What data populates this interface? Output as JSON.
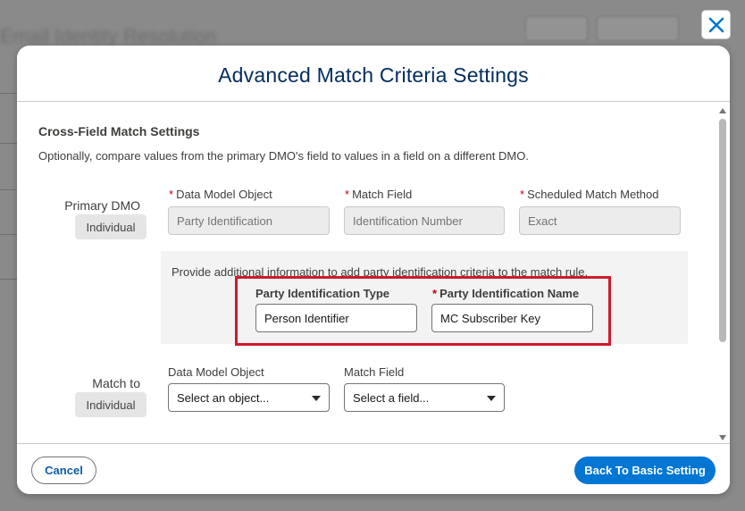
{
  "background": {
    "page_title": "Email Identity Resolution"
  },
  "close_icon": "close-icon",
  "modal": {
    "title": "Advanced Match Criteria Settings"
  },
  "section": {
    "title": "Cross-Field Match Settings",
    "description": "Optionally, compare values from the primary DMO's field to values in a field on a different DMO."
  },
  "primary": {
    "label": "Primary DMO",
    "badge": "Individual",
    "fields": [
      {
        "label": "Data Model Object",
        "required": true,
        "value": "Party Identification"
      },
      {
        "label": "Match Field",
        "required": true,
        "value": "Identification Number"
      },
      {
        "label": "Scheduled Match Method",
        "required": true,
        "value": "Exact"
      }
    ],
    "required_marker": "*"
  },
  "party_info": {
    "text": "Provide additional information to add party identification criteria to the match rule.",
    "type_label": "Party Identification Type",
    "type_value": "Person Identifier",
    "name_label": "Party Identification Name",
    "name_required": true,
    "name_value": "MC Subscriber Key"
  },
  "match_to": {
    "label": "Match to",
    "badge": "Individual",
    "object_label": "Data Model Object",
    "object_placeholder": "Select an object...",
    "field_label": "Match Field",
    "field_placeholder": "Select a field..."
  },
  "footer": {
    "cancel_label": "Cancel",
    "back_label": "Back To Basic Setting"
  },
  "colors": {
    "title": "#032d60",
    "primary_button": "#0176d3",
    "required": "#ba0517",
    "highlight": "#d11a2a"
  }
}
